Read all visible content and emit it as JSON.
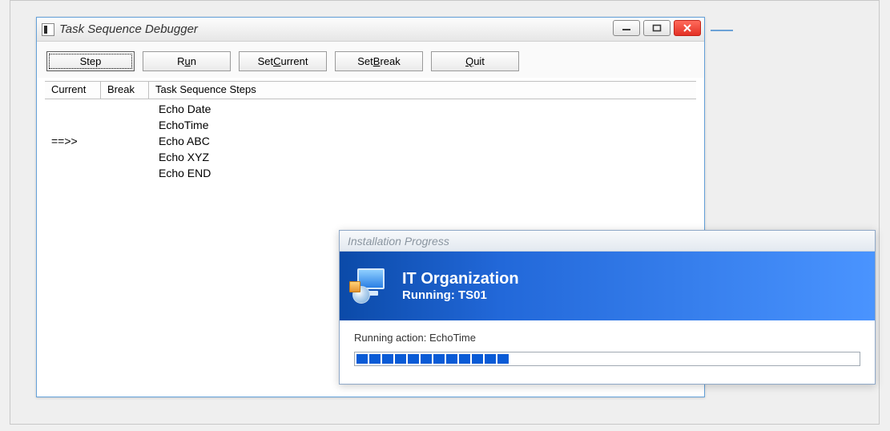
{
  "debugger": {
    "title": "Task Sequence Debugger",
    "buttons": {
      "step": "Step",
      "run_pre": "R",
      "run_u": "u",
      "run_post": "n",
      "setcurrent_pre": "Set ",
      "setcurrent_u": "C",
      "setcurrent_post": "urrent",
      "setbreak_pre": "Set ",
      "setbreak_u": "B",
      "setbreak_post": "reak",
      "quit_u": "Q",
      "quit_post": "uit"
    },
    "columns": {
      "current": "Current",
      "break": "Break",
      "steps": "Task Sequence Steps"
    },
    "rows": [
      {
        "current": "",
        "break": "",
        "step": "Echo Date"
      },
      {
        "current": "",
        "break": "",
        "step": "EchoTime"
      },
      {
        "current": "==>>",
        "break": "",
        "step": "Echo ABC"
      },
      {
        "current": "",
        "break": "",
        "step": "Echo XYZ"
      },
      {
        "current": "",
        "break": "",
        "step": "Echo END"
      }
    ]
  },
  "progress": {
    "window_title": "Installation Progress",
    "org": "IT Organization",
    "running_label": "Running: ",
    "running_value": "TS01",
    "action_label": "Running action: ",
    "action_value": "EchoTime",
    "segments": 12
  }
}
